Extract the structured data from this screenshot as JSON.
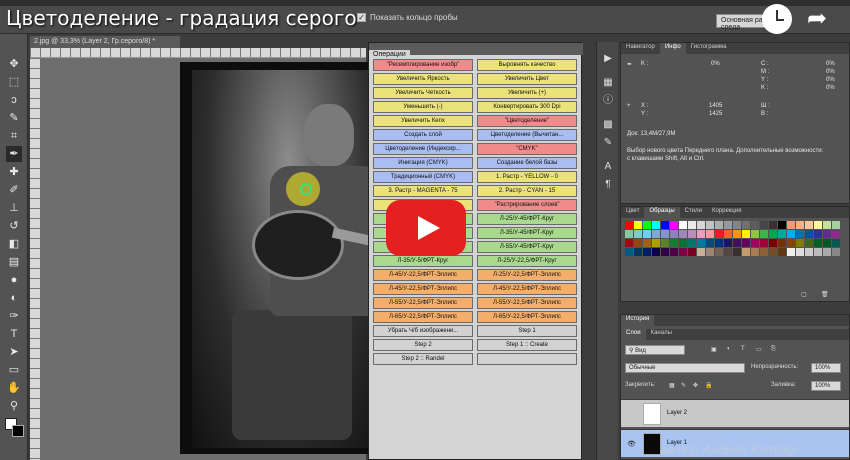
{
  "video": {
    "title": "Цветоделение - градация серого"
  },
  "options_bar": {
    "show_ring_label": "Показать кольцо пробы",
    "workspace": "Основная рабочая среда"
  },
  "document": {
    "tab_label": "2.jpg @ 33,3% (Layer 2, Гр.серого/8) *"
  },
  "actions_panel": {
    "tab": "Операции",
    "colors": {
      "red": "#ef8b8b",
      "yellow": "#ece27a",
      "blue": "#a9bdf2",
      "green": "#a8d98c",
      "orange": "#f5ae6a",
      "gray": "#d2d2d2"
    },
    "left": [
      {
        "label": "\"Ресемплирование изобр\"",
        "color": "red"
      },
      {
        "label": "Увеличить Яркость",
        "color": "yellow"
      },
      {
        "label": "Увеличить Четкость",
        "color": "yellow"
      },
      {
        "label": "Уменьшить  (-)",
        "color": "yellow"
      },
      {
        "label": "Увеличить Кепх",
        "color": "yellow"
      },
      {
        "label": "Создать слой",
        "color": "blue"
      },
      {
        "label": "Цветоделение (Индексир...",
        "color": "blue"
      },
      {
        "label": "Инигация  (CMYK)",
        "color": "blue"
      },
      {
        "label": "Традиционный  (CMYK)",
        "color": "blue"
      },
      {
        "label": "3. Растр - MAGENTA - 75",
        "color": "yellow"
      },
      {
        "label": "4. Растр",
        "color": "yellow"
      },
      {
        "label": "",
        "color": "green"
      },
      {
        "label": "",
        "color": "green"
      },
      {
        "label": "",
        "color": "green"
      },
      {
        "label": "Л-35/У-5/ФРТ-Круг",
        "color": "green"
      },
      {
        "label": "Л-45/У-22,5/ФРТ-Эллипс",
        "color": "orange"
      },
      {
        "label": "Л-45/У-22,5/ФРТ-Эллипс",
        "color": "orange"
      },
      {
        "label": "Л-55/У-22,5/ФРТ-Эллипс",
        "color": "orange"
      },
      {
        "label": "Л-65/У-22,5/ФРТ-Эллипс",
        "color": "orange"
      },
      {
        "label": "Убрать Ч/б изображени...",
        "color": "gray"
      },
      {
        "label": "Step 2",
        "color": "gray"
      },
      {
        "label": "Step 2 :: Randel",
        "color": "gray"
      }
    ],
    "right": [
      {
        "label": "Выровнять качество",
        "color": "yellow"
      },
      {
        "label": "Увеличить Цвет",
        "color": "yellow"
      },
      {
        "label": "Увеличить  (+)",
        "color": "yellow"
      },
      {
        "label": "Конвертировать  300 Dpi",
        "color": "yellow"
      },
      {
        "label": "\"Цветоделение\"",
        "color": "red"
      },
      {
        "label": "Цветоделение (Вычитан...",
        "color": "blue"
      },
      {
        "label": "\"CMYK\"",
        "color": "red"
      },
      {
        "label": "Создание белой базы",
        "color": "blue"
      },
      {
        "label": "1. Растр - YELLOW - 0",
        "color": "yellow"
      },
      {
        "label": "2. Растр - CYAN - 15",
        "color": "yellow"
      },
      {
        "label": "\"Растрирование слоев\"",
        "color": "red"
      },
      {
        "label": "Л-25/У-45/ФРТ-Круг",
        "color": "green"
      },
      {
        "label": "Л-35/У-45/ФРТ-Круг",
        "color": "green"
      },
      {
        "label": "Л-55/У-45/ФРТ-Круг",
        "color": "green"
      },
      {
        "label": "Л-25/У-22,5/ФРТ-Круг",
        "color": "green"
      },
      {
        "label": "Л-25/У-22,5/ФРТ-Эллипс",
        "color": "orange"
      },
      {
        "label": "Л-45/У-22,5/ФРТ-Эллипс",
        "color": "orange"
      },
      {
        "label": "Л-55/У-22,5/ФРТ-Эллипс",
        "color": "orange"
      },
      {
        "label": "Л-65/У-22,5/ФРТ-Эллипс",
        "color": "orange"
      },
      {
        "label": "Step 1",
        "color": "gray"
      },
      {
        "label": "Step 1 :: Create",
        "color": "gray"
      },
      {
        "label": "",
        "color": "gray"
      }
    ]
  },
  "info_panel": {
    "tabs": [
      "Навигатор",
      "Инфо",
      "Гистограмма"
    ],
    "active_tab": "Инфо",
    "k_label": "K :",
    "k_value": "0%",
    "cmyk": [
      "C :",
      "M :",
      "Y :",
      "K :"
    ],
    "cmyk_values": [
      "0%",
      "0%",
      "0%",
      "0%"
    ],
    "x_label": "X :",
    "y_label": "Y :",
    "x_value": "1405",
    "y_value": "1425",
    "w_label": "Ш :",
    "h_label": "В :",
    "doc_info": "Док: 13,4M/27,9M",
    "hint": "Выбор нового цвета Переднего плана. Дополнительные возможности: с клавишами Shift, Alt и Ctrl."
  },
  "swatches_panel": {
    "tabs": [
      "Цвет",
      "Образцы",
      "Стили",
      "Коррекция"
    ],
    "active_tab": "Образцы",
    "colors": [
      "#ff0000",
      "#ffff00",
      "#00ff00",
      "#00ffff",
      "#0000ff",
      "#ff00ff",
      "#ffffff",
      "#ebebeb",
      "#d6d6d6",
      "#c2c2c2",
      "#adadad",
      "#999999",
      "#858585",
      "#707070",
      "#5c5c5c",
      "#474747",
      "#333333",
      "#000000",
      "#f7977a",
      "#f9ad81",
      "#fdc68a",
      "#fff79a",
      "#c4df9b",
      "#a2d39c",
      "#82ca9d",
      "#7bcdc8",
      "#6ecff6",
      "#7ea7d8",
      "#8493ca",
      "#8882be",
      "#a187be",
      "#bc8dbf",
      "#f49ac2",
      "#f6989d",
      "#ed1c24",
      "#f26522",
      "#f7941d",
      "#fff200",
      "#8dc63f",
      "#39b54a",
      "#00a651",
      "#00a99d",
      "#00aeef",
      "#0072bc",
      "#0054a6",
      "#2e3192",
      "#662d91",
      "#92278f",
      "#9e0b0f",
      "#a0410d",
      "#a36209",
      "#aba000",
      "#598527",
      "#1a7b30",
      "#007236",
      "#00746b",
      "#0076a3",
      "#004b80",
      "#003471",
      "#1b1464",
      "#440e62",
      "#630460",
      "#9e005d",
      "#9e0039",
      "#790000",
      "#7b2e00",
      "#7d4900",
      "#827b00",
      "#406618",
      "#005e20",
      "#005826",
      "#005952",
      "#005b7f",
      "#003663",
      "#002157",
      "#0d004c",
      "#32004b",
      "#4b0049",
      "#7b0046",
      "#7a0026",
      "#c7b299",
      "#998675",
      "#736357",
      "#534741",
      "#37302d",
      "#c69c6d",
      "#a67c52",
      "#8c6239",
      "#754c24",
      "#603913",
      "#eeeeee",
      "#dddddd",
      "#cccccc",
      "#bbbbbb",
      "#aaaaaa",
      "#888888"
    ]
  },
  "layers_panel": {
    "history_tab": "История",
    "tabs": [
      "Слои",
      "Каналы"
    ],
    "active_tab": "Слои",
    "kind_filter": "Вид",
    "blend_mode": "Обычные",
    "opacity_label": "Непрозрачность:",
    "opacity_value": "100%",
    "lock_label": "Закрепить:",
    "fill_label": "Заливка:",
    "fill_value": "100%",
    "layers": [
      {
        "name": "Layer 2",
        "thumb_color": "#ffffff",
        "visible": false
      },
      {
        "name": "Layer 1",
        "thumb_color": "#0a0a0a",
        "visible": true
      }
    ]
  },
  "watermark": "автор Андрей Котляр"
}
